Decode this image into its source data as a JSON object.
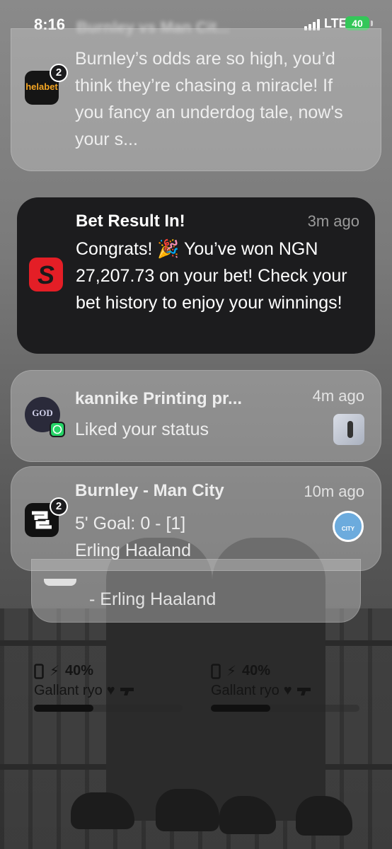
{
  "status_bar": {
    "time": "8:16",
    "blurred_title": "Burnley vs Man Cit...",
    "network": "LTE",
    "battery": "40"
  },
  "notifications": [
    {
      "app": "helabet",
      "app_icon_text": "helabet",
      "badge": "2",
      "title": "",
      "body": "Burnley’s odds are so high, you’d think they’re chasing a miracle! If you fancy an underdog tale, now's your s..."
    },
    {
      "app": "sportybet",
      "app_icon_text": "S",
      "title": "Bet Result In!",
      "time_ago": "3m ago",
      "body": "Congrats! 🎉 You’ve won NGN 27,207.73 on your bet! Check your bet history to enjoy your winnings!"
    },
    {
      "app": "whatsapp",
      "avatar_text": "GOD",
      "title": "kannike Printing pr...",
      "time_ago": "4m ago",
      "body": "Liked your status"
    },
    {
      "app": "sofascore",
      "badge": "2",
      "title": "Burnley - Man City",
      "time_ago": "10m ago",
      "body_line1": "5' Goal: 0 - [1]",
      "body_line2": "Erling Haaland",
      "crest_text": "CITY"
    }
  ],
  "stacked_notification": {
    "body": "- Erling Haaland"
  },
  "widgets": [
    {
      "battery_percent": "40%",
      "battery_level": 0.4,
      "device_name": "Gallant ryo",
      "progress_level": 0.4
    },
    {
      "battery_percent": "40%",
      "battery_level": 0.4,
      "device_name": "Gallant ryo",
      "progress_level": 0.4
    }
  ],
  "colors": {
    "battery_green": "#34c759",
    "sporty_red": "#e41e26",
    "whatsapp_green": "#25d366",
    "city_blue": "#6cabdd"
  }
}
